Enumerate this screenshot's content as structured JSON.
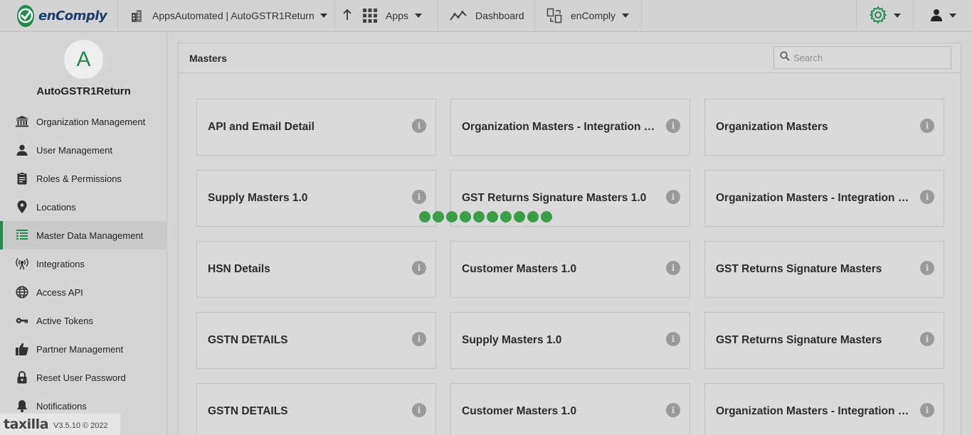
{
  "topbar": {
    "brand": "enComply",
    "org_selector": "AppsAutomated | AutoGSTR1Return",
    "apps_label": "Apps",
    "dashboard_label": "Dashboard",
    "product_label": "enComply"
  },
  "sidebar": {
    "avatar_letter": "A",
    "org_name": "AutoGSTR1Return",
    "items": [
      {
        "label": "Organization Management",
        "icon": "bank-icon"
      },
      {
        "label": "User Management",
        "icon": "person-icon"
      },
      {
        "label": "Roles & Permissions",
        "icon": "clipboard-icon"
      },
      {
        "label": "Locations",
        "icon": "location-pin-icon"
      },
      {
        "label": "Master Data Management",
        "icon": "table-icon",
        "active": true
      },
      {
        "label": "Integrations",
        "icon": "antenna-icon"
      },
      {
        "label": "Access API",
        "icon": "globe-icon"
      },
      {
        "label": "Active Tokens",
        "icon": "key-icon"
      },
      {
        "label": "Partner Management",
        "icon": "thumbs-up-icon"
      },
      {
        "label": "Reset User Password",
        "icon": "lock-icon"
      },
      {
        "label": "Notifications",
        "icon": "bell-icon"
      }
    ],
    "footer_brand": "taxilla",
    "footer_version": "V3.5.10 © 2022"
  },
  "main": {
    "title": "Masters",
    "search_placeholder": "Search",
    "cards": [
      "API and Email Detail",
      "Organization Masters - Integration Masters",
      "Organization Masters",
      "Supply Masters 1.0",
      "GST Returns Signature Masters 1.0",
      "Organization Masters - Integration Masters",
      "HSN Details",
      "Customer Masters 1.0",
      "GST Returns Signature Masters",
      "GSTN DETAILS",
      "Supply Masters 1.0",
      "GST Returns Signature Masters",
      "GSTN DETAILS",
      "Customer Masters 1.0",
      "Organization Masters - Integration Masters"
    ]
  },
  "colors": {
    "accent": "#1f8a4c",
    "loader": "#3a9e48",
    "brand_text": "#1d3c6a"
  }
}
